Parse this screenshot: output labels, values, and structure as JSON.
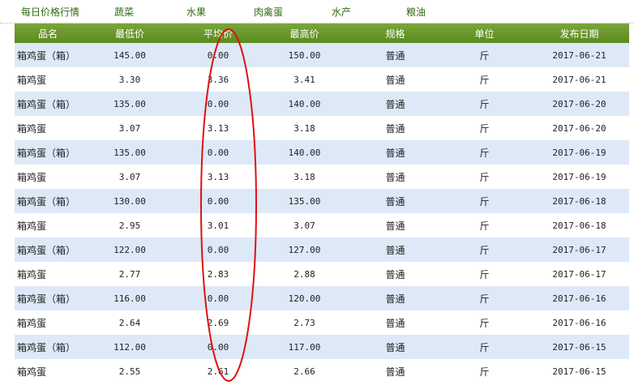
{
  "nav": {
    "title": "每日价格行情",
    "items": [
      "蔬菜",
      "水果",
      "肉禽蛋",
      "水产",
      "粮油"
    ]
  },
  "table": {
    "headers": [
      "品名",
      "最低价",
      "平均价",
      "最高价",
      "规格",
      "单位",
      "发布日期"
    ],
    "rows": [
      [
        "箱鸡蛋（箱）",
        "145.00",
        "0.00",
        "150.00",
        "普通",
        "斤",
        "2017-06-21"
      ],
      [
        "箱鸡蛋",
        "3.30",
        "3.36",
        "3.41",
        "普通",
        "斤",
        "2017-06-21"
      ],
      [
        "箱鸡蛋（箱）",
        "135.00",
        "0.00",
        "140.00",
        "普通",
        "斤",
        "2017-06-20"
      ],
      [
        "箱鸡蛋",
        "3.07",
        "3.13",
        "3.18",
        "普通",
        "斤",
        "2017-06-20"
      ],
      [
        "箱鸡蛋（箱）",
        "135.00",
        "0.00",
        "140.00",
        "普通",
        "斤",
        "2017-06-19"
      ],
      [
        "箱鸡蛋",
        "3.07",
        "3.13",
        "3.18",
        "普通",
        "斤",
        "2017-06-19"
      ],
      [
        "箱鸡蛋（箱）",
        "130.00",
        "0.00",
        "135.00",
        "普通",
        "斤",
        "2017-06-18"
      ],
      [
        "箱鸡蛋",
        "2.95",
        "3.01",
        "3.07",
        "普通",
        "斤",
        "2017-06-18"
      ],
      [
        "箱鸡蛋（箱）",
        "122.00",
        "0.00",
        "127.00",
        "普通",
        "斤",
        "2017-06-17"
      ],
      [
        "箱鸡蛋",
        "2.77",
        "2.83",
        "2.88",
        "普通",
        "斤",
        "2017-06-17"
      ],
      [
        "箱鸡蛋（箱）",
        "116.00",
        "0.00",
        "120.00",
        "普通",
        "斤",
        "2017-06-16"
      ],
      [
        "箱鸡蛋",
        "2.64",
        "2.69",
        "2.73",
        "普通",
        "斤",
        "2017-06-16"
      ],
      [
        "箱鸡蛋（箱）",
        "112.00",
        "0.00",
        "117.00",
        "普通",
        "斤",
        "2017-06-15"
      ],
      [
        "箱鸡蛋",
        "2.55",
        "2.61",
        "2.66",
        "普通",
        "斤",
        "2017-06-15"
      ]
    ]
  },
  "colors": {
    "header_green": "#5a8a1e",
    "nav_text": "#2f6a12",
    "row_alt": "#dde9f7",
    "annotation_red": "#e01010"
  }
}
